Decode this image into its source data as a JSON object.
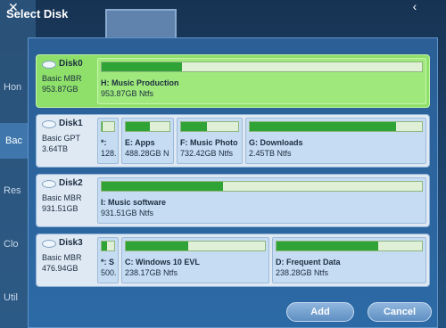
{
  "window": {
    "title": "Select Disk"
  },
  "background": {
    "nav": [
      {
        "label": "Hon"
      },
      {
        "label": "Bac"
      },
      {
        "label": "Res"
      },
      {
        "label": "Clo"
      },
      {
        "label": "Util"
      }
    ]
  },
  "disks": [
    {
      "name": "Disk0",
      "type": "Basic MBR",
      "size": "953.87GB",
      "selected": true,
      "partitions": [
        {
          "label": "H: Music Production",
          "detail": "953.87GB Ntfs",
          "used_fraction": 0.25
        }
      ]
    },
    {
      "name": "Disk1",
      "type": "Basic GPT",
      "size": "3.64TB",
      "selected": false,
      "partitions": [
        {
          "label": "*:",
          "detail": "128.",
          "used_fraction": 0.05
        },
        {
          "label": "E: Apps",
          "detail": "488.28GB N",
          "used_fraction": 0.55
        },
        {
          "label": "F: Music Photo",
          "detail": "732.42GB Ntfs",
          "used_fraction": 0.45
        },
        {
          "label": "G: Downloads",
          "detail": "2.45TB Ntfs",
          "used_fraction": 0.85
        }
      ]
    },
    {
      "name": "Disk2",
      "type": "Basic MBR",
      "size": "931.51GB",
      "selected": false,
      "partitions": [
        {
          "label": "I: Music software",
          "detail": "931.51GB Ntfs",
          "used_fraction": 0.38
        }
      ]
    },
    {
      "name": "Disk3",
      "type": "Basic MBR",
      "size": "476.94GB",
      "selected": false,
      "partitions": [
        {
          "label": "*: S",
          "detail": "500.",
          "used_fraction": 0.4
        },
        {
          "label": "C: Windows 10 EVL",
          "detail": "238.17GB Ntfs",
          "used_fraction": 0.45
        },
        {
          "label": "D: Frequent Data",
          "detail": "238.28GB Ntfs",
          "used_fraction": 0.7
        }
      ]
    }
  ],
  "buttons": {
    "add": "Add",
    "cancel": "Cancel"
  },
  "colors": {
    "accent": "#2fa336",
    "selected_row": "#8ee06a",
    "dialog_bg": "#2c6aa6"
  },
  "icons": {
    "close": "close-icon",
    "collapse": "chevron-up-icon",
    "disk": "disk-icon"
  }
}
